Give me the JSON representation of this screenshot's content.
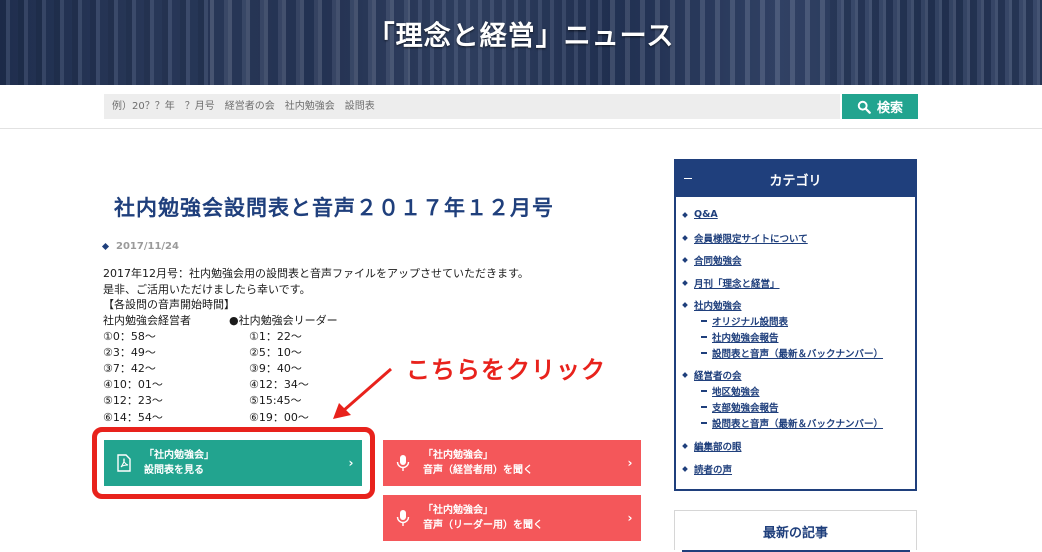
{
  "header": {
    "title": "「理念と経営」ニュース"
  },
  "search": {
    "placeholder": "例）20？？年　？月号　経営者の会　社内勉強会　設問表",
    "button_label": "検索",
    "button_color": "#22a48f"
  },
  "post": {
    "title": "社内勉強会設問表と音声２０１７年１２月号",
    "date": "2017/11/24",
    "body": [
      "2017年12月号：社内勉強会用の設問表と音声ファイルをアップさせていただきます。",
      "是非、ご活用いただけましたら幸いです。",
      "【各設問の音声開始時間】"
    ],
    "times_manager": {
      "heading": "社内勉強会経営者",
      "items": [
        "①0：58～",
        "②3：49～",
        "③7：42～",
        "④10：01～",
        "⑤12：23～",
        "⑥14：54～"
      ]
    },
    "times_leader": {
      "heading": "●社内勉強会リーダー",
      "items": [
        "①1：22～",
        "②5：10～",
        "③9：40～",
        "④12：34～",
        "⑤15:45～",
        "⑥19：00～"
      ]
    }
  },
  "annotation": {
    "text": "こちらをクリック",
    "color": "#e8221c"
  },
  "buttons": [
    {
      "line1": "「社内勉強会」",
      "line2": "設問表を見る",
      "icon": "pdf-icon",
      "color": "#22a48f"
    },
    {
      "line1": "「社内勉強会」",
      "line2": "音声（経営者用）を聞く",
      "icon": "microphone-icon",
      "color": "#f4575a"
    },
    {
      "line1": "「社内勉強会」",
      "line2": "音声（リーダー用）を聞く",
      "icon": "microphone-icon",
      "color": "#f4575a"
    }
  ],
  "sidebar": {
    "category_title": "カテゴリ",
    "categories": [
      {
        "label": "Q&A",
        "children": []
      },
      {
        "label": "会員様限定サイトについて",
        "children": []
      },
      {
        "label": "合同勉強会",
        "children": []
      },
      {
        "label": "月刊「理念と経営」",
        "children": []
      },
      {
        "label": "社内勉強会",
        "children": [
          "オリジナル設問表",
          "社内勉強会報告",
          "設問表と音声（最新＆バックナンバー）"
        ]
      },
      {
        "label": "経営者の会",
        "children": [
          "地区勉強会",
          "支部勉強会報告",
          "設問表と音声（最新＆バックナンバー）"
        ]
      },
      {
        "label": "編集部の眼",
        "children": []
      },
      {
        "label": "読者の声",
        "children": []
      }
    ],
    "recent_title": "最新の記事",
    "accent_color": "#1f3f7c"
  }
}
